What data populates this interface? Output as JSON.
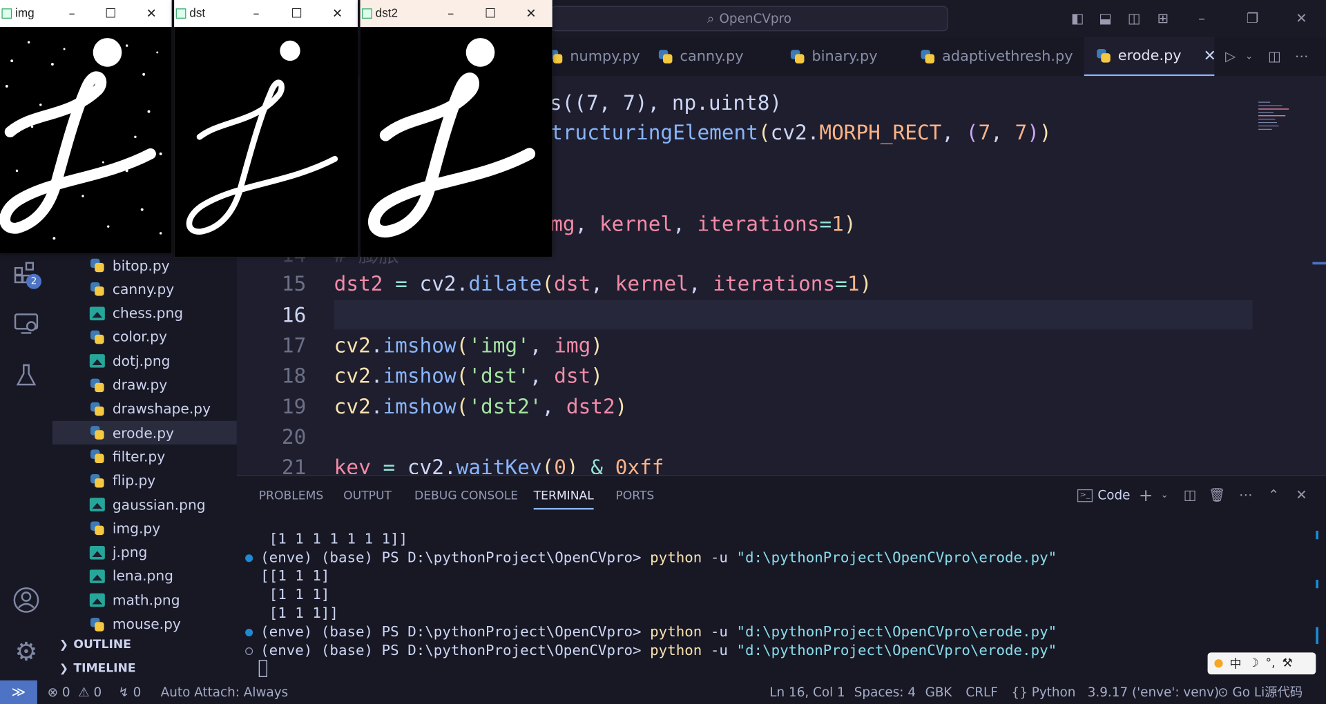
{
  "window": {
    "search_text": "OpenCVpro"
  },
  "tabs": [
    {
      "label": "numpy.py"
    },
    {
      "label": "canny.py"
    },
    {
      "label": "binary.py"
    },
    {
      "label": "adaptivethresh.py"
    },
    {
      "label": "erode.py",
      "active": true
    }
  ],
  "activity": {
    "extensions_badge": "2"
  },
  "explorer": {
    "files": [
      {
        "name": "bitop.py",
        "type": "py"
      },
      {
        "name": "canny.py",
        "type": "py"
      },
      {
        "name": "chess.png",
        "type": "png"
      },
      {
        "name": "color.py",
        "type": "py"
      },
      {
        "name": "dotj.png",
        "type": "png"
      },
      {
        "name": "draw.py",
        "type": "py"
      },
      {
        "name": "drawshape.py",
        "type": "py"
      },
      {
        "name": "erode.py",
        "type": "py",
        "selected": true
      },
      {
        "name": "filter.py",
        "type": "py"
      },
      {
        "name": "flip.py",
        "type": "py"
      },
      {
        "name": "gaussian.png",
        "type": "png"
      },
      {
        "name": "img.py",
        "type": "py"
      },
      {
        "name": "j.png",
        "type": "png"
      },
      {
        "name": "lena.png",
        "type": "png"
      },
      {
        "name": "math.png",
        "type": "png"
      },
      {
        "name": "mouse.py",
        "type": "py"
      }
    ],
    "outline_label": "OUTLINE",
    "timeline_label": "TIMELINE"
  },
  "editor": {
    "lines": [
      {
        "num": "",
        "frag": "s((7, 7), np.uint8)"
      },
      {
        "num": "",
        "frag": "tructuringElement(cv2.MORPH_RECT, (7, 7))"
      },
      {
        "num": "",
        "frag": "mg, kernel, iterations=1)"
      },
      {
        "num": "14",
        "frag": "# 膨胀"
      },
      {
        "num": "15",
        "frag": "dst2 = cv2.dilate(dst, kernel, iterations=1)"
      },
      {
        "num": "16",
        "frag": ""
      },
      {
        "num": "17",
        "frag": "cv2.imshow('img', img)"
      },
      {
        "num": "18",
        "frag": "cv2.imshow('dst', dst)"
      },
      {
        "num": "19",
        "frag": "cv2.imshow('dst2', dst2)"
      },
      {
        "num": "20",
        "frag": ""
      },
      {
        "num": "21",
        "frag": "key = cv2.waitKey(0) & 0xff"
      }
    ]
  },
  "panel": {
    "tabs": [
      "PROBLEMS",
      "OUTPUT",
      "DEBUG CONSOLE",
      "TERMINAL",
      "PORTS"
    ],
    "active_tab": "TERMINAL",
    "shell_label": "Code",
    "terminal": [
      {
        "text": " [1 1 1 1 1 1 1]]",
        "prompt": false
      },
      {
        "prompt": true,
        "dot": "blue",
        "env": "(enve) (base) PS D:\\pythonProject\\OpenCVpro> ",
        "cmd": "python",
        "flag": " -u ",
        "path": "\"d:\\pythonProject\\OpenCVpro\\erode.py\""
      },
      {
        "text": "[[1 1 1]",
        "prompt": false
      },
      {
        "text": " [1 1 1]",
        "prompt": false
      },
      {
        "text": " [1 1 1]]",
        "prompt": false
      },
      {
        "prompt": true,
        "dot": "blue",
        "env": "(enve) (base) PS D:\\pythonProject\\OpenCVpro> ",
        "cmd": "python",
        "flag": " -u ",
        "path": "\"d:\\pythonProject\\OpenCVpro\\erode.py\""
      },
      {
        "prompt": true,
        "dot": "hollow",
        "env": "(enve) (base) PS D:\\pythonProject\\OpenCVpro> ",
        "cmd": "python",
        "flag": " -u ",
        "path": "\"d:\\pythonProject\\OpenCVpro\\erode.py\""
      }
    ],
    "ime": "中"
  },
  "status": {
    "errors": "0",
    "warnings": "0",
    "ports": "0",
    "auto_attach": "Auto Attach: Always",
    "position": "Ln 16, Col 1",
    "spaces": "Spaces: 4",
    "encoding": "GBK",
    "eol": "CRLF",
    "language": "Python",
    "interpreter": "3.9.17 ('enve': venv)",
    "golive": "Go Li源代码"
  },
  "cv_windows": [
    {
      "title": "img"
    },
    {
      "title": "dst"
    },
    {
      "title": "dst2"
    }
  ],
  "colors": {
    "accent": "#89b4fa",
    "background": "#1e1e2e",
    "sidebar": "#181825"
  }
}
